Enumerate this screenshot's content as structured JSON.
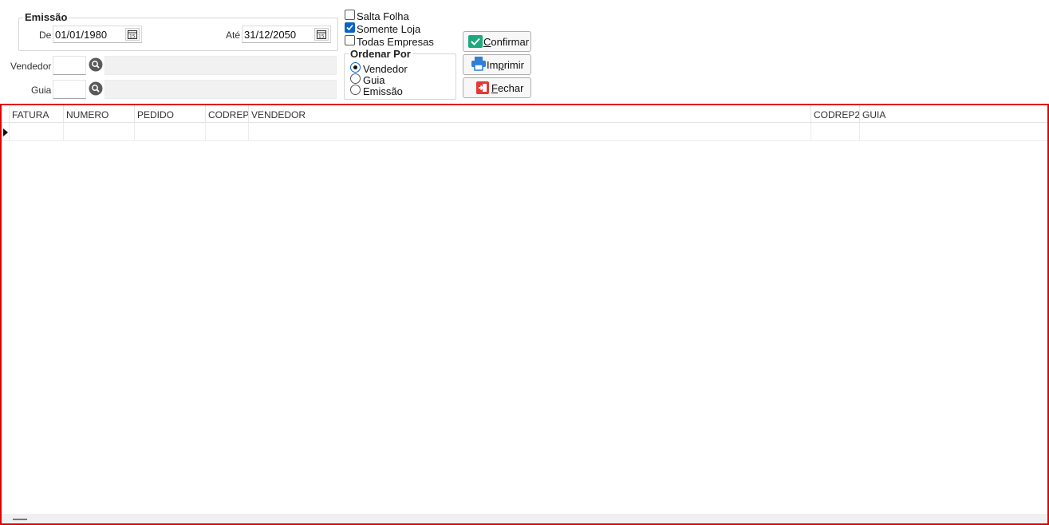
{
  "emissao": {
    "title": "Emissão",
    "de_label": "De",
    "de_value": "01/01/1980",
    "ate_label": "Até",
    "ate_value": "31/12/2050"
  },
  "vendedor": {
    "label": "Vendedor",
    "code": "",
    "name": ""
  },
  "guia": {
    "label": "Guia",
    "code": "",
    "name": ""
  },
  "options": {
    "salta_folha": {
      "label": "Salta Folha",
      "checked": false
    },
    "somente_loja": {
      "label": "Somente Loja",
      "checked": true
    },
    "todas_empresas": {
      "label": "Todas Empresas",
      "checked": false
    }
  },
  "ordenar": {
    "title": "Ordenar Por",
    "items": [
      {
        "label": "Vendedor",
        "selected": true
      },
      {
        "label": "Guia",
        "selected": false
      },
      {
        "label": "Emissão",
        "selected": false
      }
    ]
  },
  "buttons": {
    "confirmar": {
      "pre": "",
      "accel": "C",
      "post": "onfirmar"
    },
    "imprimir": {
      "pre": "Im",
      "accel": "p",
      "post": "rimir"
    },
    "fechar": {
      "pre": "",
      "accel": "F",
      "post": "echar"
    }
  },
  "grid": {
    "columns": [
      "FATURA",
      "NUMERO",
      "PEDIDO",
      "CODREP",
      "VENDEDOR",
      "CODREP2",
      "GUIA"
    ]
  },
  "colors": {
    "accent": "#0a62c9",
    "grid_border": "#e00000",
    "confirm_icon": "#1ea97c",
    "print_icon": "#2f7fd6",
    "close_icon": "#e53935"
  }
}
